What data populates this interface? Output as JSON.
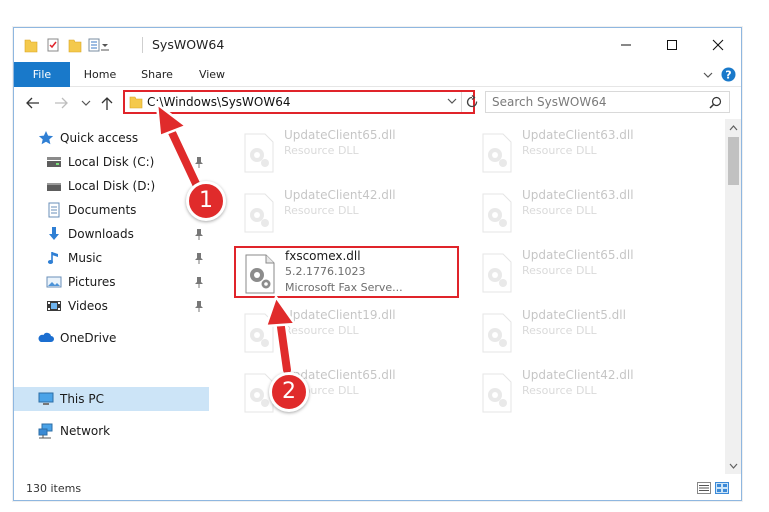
{
  "window": {
    "title": "SysWOW64"
  },
  "ribbon": {
    "tabs": [
      "File",
      "Home",
      "Share",
      "View"
    ]
  },
  "address": {
    "path": "C:\\Windows\\SysWOW64"
  },
  "search": {
    "placeholder": "Search SysWOW64"
  },
  "sidebar": {
    "items": [
      {
        "label": "Quick access",
        "icon": "star-icon",
        "pinned": false
      },
      {
        "label": "Local Disk (C:)",
        "icon": "drive-icon",
        "pinned": true
      },
      {
        "label": "Local Disk (D:)",
        "icon": "drive-icon",
        "pinned": false
      },
      {
        "label": "Documents",
        "icon": "documents-icon",
        "pinned": true
      },
      {
        "label": "Downloads",
        "icon": "downloads-icon",
        "pinned": true
      },
      {
        "label": "Music",
        "icon": "music-icon",
        "pinned": true
      },
      {
        "label": "Pictures",
        "icon": "pictures-icon",
        "pinned": true
      },
      {
        "label": "Videos",
        "icon": "videos-icon",
        "pinned": true
      },
      {
        "label": "OneDrive",
        "icon": "onedrive-icon",
        "pinned": false
      },
      {
        "label": "This PC",
        "icon": "this-pc-icon",
        "pinned": false,
        "selected": true
      },
      {
        "label": "Network",
        "icon": "network-icon",
        "pinned": false
      }
    ]
  },
  "files": [
    {
      "name": "UpdateClient65.dll",
      "type": "Resource DLL",
      "faded": true
    },
    {
      "name": "UpdateClient63.dll",
      "type": "Resource DLL",
      "faded": true
    },
    {
      "name": "UpdateClient42.dll",
      "type": "Resource DLL",
      "faded": true
    },
    {
      "name": "UpdateClient63.dll",
      "type": "Resource DLL",
      "faded": true
    },
    {
      "name": "fxscomex.dll",
      "version": "5.2.1776.1023",
      "description": "Microsoft Fax Serve...",
      "faded": false,
      "highlighted": true
    },
    {
      "name": "UpdateClient65.dll",
      "type": "Resource DLL",
      "faded": true
    },
    {
      "name": "UpdateClient19.dll",
      "type": "Resource DLL",
      "faded": true
    },
    {
      "name": "UpdateClient5.dll",
      "type": "Resource DLL",
      "faded": true
    },
    {
      "name": "UpdateClient65.dll",
      "type": "Resource DLL",
      "faded": true
    },
    {
      "name": "UpdateClient42.dll",
      "type": "Resource DLL",
      "faded": true
    }
  ],
  "status": {
    "item_count": "130 items"
  },
  "annotations": {
    "step1": "1",
    "step2": "2"
  },
  "colors": {
    "accent": "#1979ca",
    "highlight": "#e0242a",
    "selected": "#cce4f7"
  }
}
